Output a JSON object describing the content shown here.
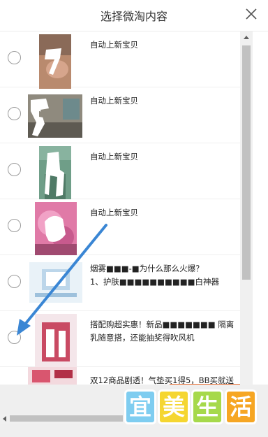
{
  "dialog": {
    "title": "选择微淘内容"
  },
  "items": [
    {
      "text": "自动上新宝贝"
    },
    {
      "text": "自动上新宝贝"
    },
    {
      "text": "自动上新宝贝"
    },
    {
      "text": "自动上新宝贝"
    },
    {
      "text": "烟雾■■■-■为什么那么火爆？\n1、护肤■■■■■■■■■■白神器"
    },
    {
      "text": "搭配购超实惠！新品■■■■■■■  隔离乳随意搭，还能抽奖得吹风机"
    },
    {
      "text": "双12商品剧透！气垫买1得5，BB买就送"
    }
  ],
  "watermark": {
    "chars": [
      "宜",
      "美",
      "生",
      "活"
    ],
    "colors": [
      "#7fcdf0",
      "#f5d631",
      "#a6d94b",
      "#f6a623"
    ]
  },
  "colors": {
    "arrow": "#3a86d4",
    "accent": "#e86a2c"
  },
  "icons": {
    "close": "close-icon",
    "pointer": "arrow-pointer"
  }
}
